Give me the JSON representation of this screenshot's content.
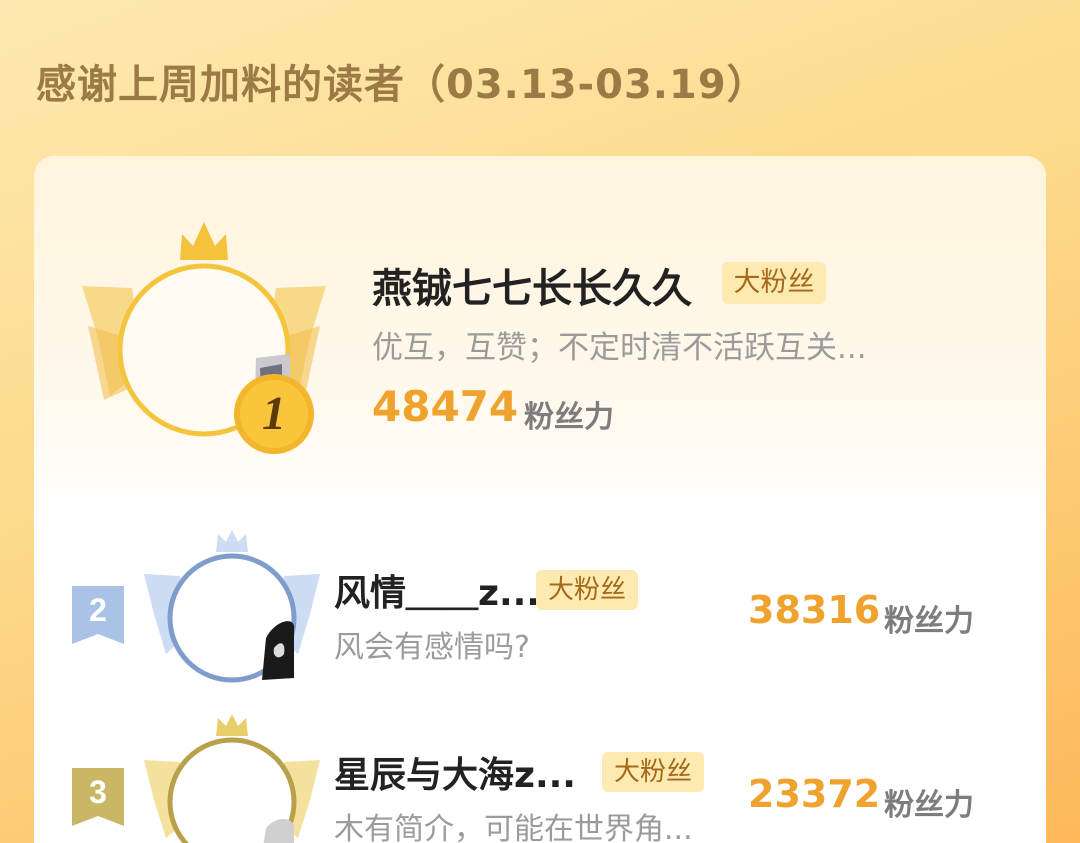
{
  "page_title": "感谢上周加料的读者（03.13-03.19）",
  "colors": {
    "gold": "#f0a22e",
    "silver_blue": "#7f9ccc",
    "bronze": "#b9a04a",
    "badge_bg": "#fdeab0"
  },
  "fans": [
    {
      "rank": "1",
      "name": "燕铖七七长长久久",
      "badge": "大粉丝",
      "description": "优互，互赞；不定时清不活跃互关...",
      "score": "48474",
      "score_unit": "粉丝力",
      "frame": "gold-crown-frame"
    },
    {
      "rank": "2",
      "name": "风情＿＿z...",
      "badge": "大粉丝",
      "description": "风会有感情吗?",
      "score": "38316",
      "score_unit": "粉丝力",
      "frame": "silver-crown-frame"
    },
    {
      "rank": "3",
      "name": "星辰与大海z...",
      "badge": "大粉丝",
      "description": "木有简介，可能在世界角...",
      "score": "23372",
      "score_unit": "粉丝力",
      "frame": "bronze-crown-frame"
    }
  ]
}
